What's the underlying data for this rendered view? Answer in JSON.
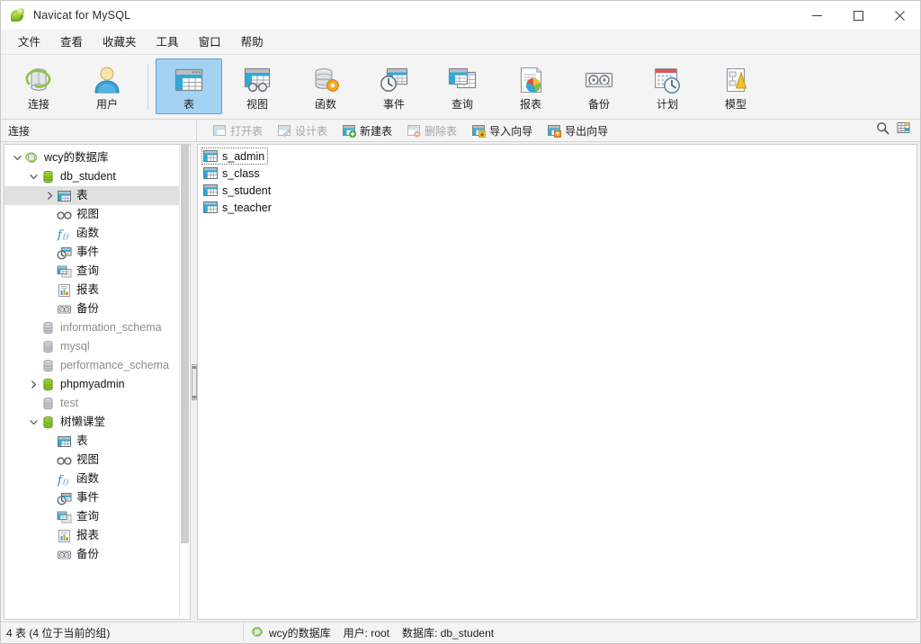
{
  "window": {
    "title": "Navicat for MySQL",
    "app_icon": "navicat-leaf-icon",
    "controls": {
      "minimize": "minimize-icon",
      "maximize": "maximize-icon",
      "close": "close-icon"
    }
  },
  "menu": {
    "items": [
      {
        "label": "文件"
      },
      {
        "label": "查看"
      },
      {
        "label": "收藏夹"
      },
      {
        "label": "工具"
      },
      {
        "label": "窗口"
      },
      {
        "label": "帮助"
      }
    ]
  },
  "toolbar": {
    "groups": [
      {
        "buttons": [
          {
            "label": "连接",
            "icon": "connection-icon",
            "active": false
          },
          {
            "label": "用户",
            "icon": "user-icon",
            "active": false
          }
        ]
      },
      {
        "buttons": [
          {
            "label": "表",
            "icon": "table-icon",
            "active": true
          },
          {
            "label": "视图",
            "icon": "view-icon",
            "active": false
          },
          {
            "label": "函数",
            "icon": "function-icon",
            "active": false
          },
          {
            "label": "事件",
            "icon": "event-icon",
            "active": false
          },
          {
            "label": "查询",
            "icon": "query-icon",
            "active": false
          },
          {
            "label": "报表",
            "icon": "report-icon",
            "active": false
          },
          {
            "label": "备份",
            "icon": "backup-icon",
            "active": false
          },
          {
            "label": "计划",
            "icon": "schedule-icon",
            "active": false
          },
          {
            "label": "模型",
            "icon": "model-icon",
            "active": false
          }
        ]
      }
    ]
  },
  "subtoolbar": {
    "panel_label": "连接",
    "actions": [
      {
        "label": "打开表",
        "icon": "open-table-icon",
        "disabled": true
      },
      {
        "label": "设计表",
        "icon": "design-table-icon",
        "disabled": true
      },
      {
        "label": "新建表",
        "icon": "new-table-icon",
        "disabled": false
      },
      {
        "label": "删除表",
        "icon": "delete-table-icon",
        "disabled": true
      },
      {
        "label": "导入向导",
        "icon": "import-wizard-icon",
        "disabled": false
      },
      {
        "label": "导出向导",
        "icon": "export-wizard-icon",
        "disabled": false
      }
    ],
    "tools": [
      {
        "icon": "search-icon",
        "name": "search-icon"
      },
      {
        "icon": "grid-view-icon",
        "name": "grid-view-icon"
      }
    ]
  },
  "sidebar": {
    "nodes": [
      {
        "label": "wcy的数据库",
        "icon": "connection-icon",
        "indent": 0,
        "twisty": "down",
        "dim": false,
        "selected": false
      },
      {
        "label": "db_student",
        "icon": "database-green-icon",
        "indent": 1,
        "twisty": "down",
        "dim": false,
        "selected": false
      },
      {
        "label": "表",
        "icon": "table-icon",
        "indent": 2,
        "twisty": "right",
        "dim": false,
        "selected": true
      },
      {
        "label": "视图",
        "icon": "view-icon",
        "indent": 2,
        "twisty": "none",
        "dim": false,
        "selected": false
      },
      {
        "label": "函数",
        "icon": "function-icon",
        "indent": 2,
        "twisty": "none",
        "dim": false,
        "selected": false
      },
      {
        "label": "事件",
        "icon": "event-icon",
        "indent": 2,
        "twisty": "none",
        "dim": false,
        "selected": false
      },
      {
        "label": "查询",
        "icon": "query-icon",
        "indent": 2,
        "twisty": "none",
        "dim": false,
        "selected": false
      },
      {
        "label": "报表",
        "icon": "report-icon",
        "indent": 2,
        "twisty": "none",
        "dim": false,
        "selected": false
      },
      {
        "label": "备份",
        "icon": "backup-icon",
        "indent": 2,
        "twisty": "none",
        "dim": false,
        "selected": false
      },
      {
        "label": "information_schema",
        "icon": "database-grey-icon",
        "indent": 1,
        "twisty": "none",
        "dim": false,
        "selected": false
      },
      {
        "label": "mysql",
        "icon": "database-grey-icon",
        "indent": 1,
        "twisty": "none",
        "dim": false,
        "selected": false
      },
      {
        "label": "performance_schema",
        "icon": "database-grey-icon",
        "indent": 1,
        "twisty": "none",
        "dim": false,
        "selected": false
      },
      {
        "label": "phpmyadmin",
        "icon": "database-green-icon",
        "indent": 1,
        "twisty": "right",
        "dim": false,
        "selected": false
      },
      {
        "label": "test",
        "icon": "database-grey-icon",
        "indent": 1,
        "twisty": "none",
        "dim": false,
        "selected": false
      },
      {
        "label": "树懒课堂",
        "icon": "database-green-icon",
        "indent": 1,
        "twisty": "down",
        "dim": false,
        "selected": false
      },
      {
        "label": "表",
        "icon": "table-icon",
        "indent": 2,
        "twisty": "none",
        "dim": false,
        "selected": false
      },
      {
        "label": "视图",
        "icon": "view-icon",
        "indent": 2,
        "twisty": "none",
        "dim": false,
        "selected": false
      },
      {
        "label": "函数",
        "icon": "function-icon",
        "indent": 2,
        "twisty": "none",
        "dim": false,
        "selected": false
      },
      {
        "label": "事件",
        "icon": "event-icon",
        "indent": 2,
        "twisty": "none",
        "dim": false,
        "selected": false
      },
      {
        "label": "查询",
        "icon": "query-icon",
        "indent": 2,
        "twisty": "none",
        "dim": false,
        "selected": false
      },
      {
        "label": "报表",
        "icon": "report-icon",
        "indent": 2,
        "twisty": "none",
        "dim": false,
        "selected": false
      },
      {
        "label": "备份",
        "icon": "backup-icon",
        "indent": 2,
        "twisty": "none",
        "dim": false,
        "selected": false
      }
    ]
  },
  "content": {
    "tables": [
      {
        "name": "s_admin",
        "focused": true
      },
      {
        "name": "s_class",
        "focused": false
      },
      {
        "name": "s_student",
        "focused": false
      },
      {
        "name": "s_teacher",
        "focused": false
      }
    ]
  },
  "statusbar": {
    "count_text": "4 表 (4 位于当前的组)",
    "connection": "wcy的数据库",
    "user": "用户: root",
    "database": "数据库: db_student"
  },
  "colors": {
    "accent_blue": "#a3d2f2",
    "accent_border": "#5ca2d8",
    "selection_grey": "#e0e0e0",
    "chrome": "#f4f4f4",
    "table_icon_blue": "#29a8d8",
    "db_green": "#7ec11c"
  }
}
